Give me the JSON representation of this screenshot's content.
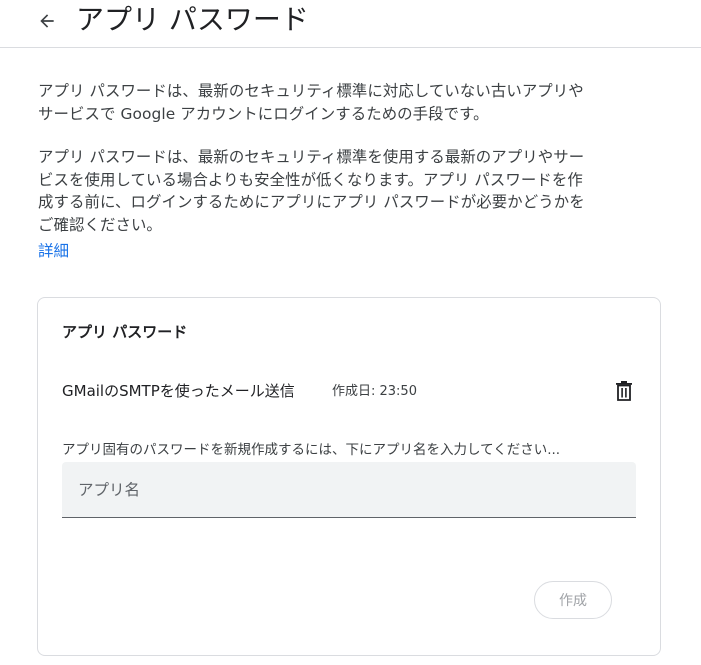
{
  "header": {
    "title": "アプリ パスワード",
    "back_icon": "arrow-back-icon"
  },
  "intro": {
    "paragraph1": "アプリ パスワードは、最新のセキュリティ標準に対応していない古いアプリやサービスで Google アカウントにログインするための手段です。",
    "paragraph2": "アプリ パスワードは、最新のセキュリティ標準を使用する最新のアプリやサービスを使用している場合よりも安全性が低くなります。アプリ パスワードを作成する前に、ログインするためにアプリにアプリ パスワードが必要かどうかをご確認ください。",
    "learn_more": "詳細"
  },
  "card": {
    "title": "アプリ パスワード",
    "passwords": [
      {
        "name": "GMailのSMTPを使ったメール送信",
        "created": "作成日: 23:50",
        "delete_icon": "trash-icon"
      }
    ],
    "hint": "アプリ固有のパスワードを新規作成するには、下にアプリ名を入力してください...",
    "input_placeholder": "アプリ名",
    "input_value": "",
    "create_label": "作成"
  },
  "colors": {
    "link": "#1a73e8",
    "border": "#dadce0",
    "input_bg": "#f1f3f4",
    "disabled_text": "#a0a3a7"
  }
}
